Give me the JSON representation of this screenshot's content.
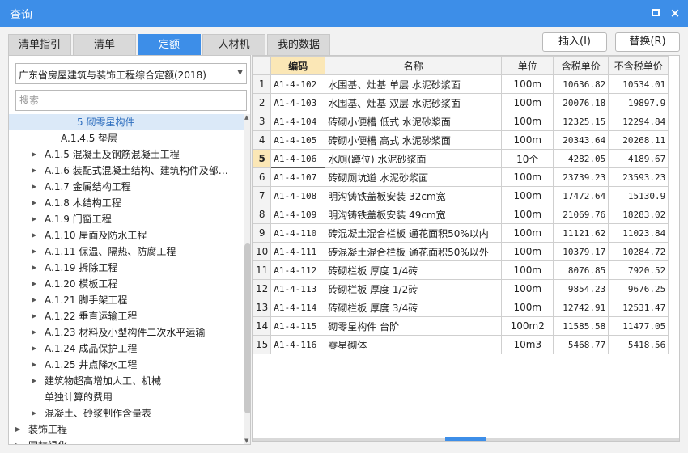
{
  "window": {
    "title": "查询",
    "maximize_label": "",
    "close_label": "×"
  },
  "tabs": [
    {
      "label": "清单指引"
    },
    {
      "label": "清单"
    },
    {
      "label": "定额"
    },
    {
      "label": "人材机"
    },
    {
      "label": "我的数据"
    }
  ],
  "active_tab": 2,
  "actions": {
    "insert_label": "插入(I)",
    "replace_label": "替换(R)"
  },
  "left": {
    "library": "广东省房屋建筑与装饰工程综合定额(2018)",
    "search_placeholder": "搜索",
    "tree": [
      {
        "label": "5 砌零星构件",
        "caret": "",
        "selected": true
      },
      {
        "label": "A.1.4.5 垫层",
        "caret": ""
      },
      {
        "label": "A.1.5 混凝土及钢筋混凝土工程",
        "caret": "▶"
      },
      {
        "label": "A.1.6 装配式混凝土结构、建筑构件及部…",
        "caret": "▶"
      },
      {
        "label": "A.1.7 金属结构工程",
        "caret": "▶"
      },
      {
        "label": "A.1.8 木结构工程",
        "caret": "▶"
      },
      {
        "label": "A.1.9 门窗工程",
        "caret": "▶"
      },
      {
        "label": "A.1.10 屋面及防水工程",
        "caret": "▶"
      },
      {
        "label": "A.1.11 保温、隔热、防腐工程",
        "caret": "▶"
      },
      {
        "label": "A.1.19 拆除工程",
        "caret": "▶"
      },
      {
        "label": "A.1.20 模板工程",
        "caret": "▶"
      },
      {
        "label": "A.1.21 脚手架工程",
        "caret": "▶"
      },
      {
        "label": "A.1.22 垂直运输工程",
        "caret": "▶"
      },
      {
        "label": "A.1.23 材料及小型构件二次水平运输",
        "caret": "▶"
      },
      {
        "label": "A.1.24 成品保护工程",
        "caret": "▶"
      },
      {
        "label": "A.1.25 井点降水工程",
        "caret": "▶"
      },
      {
        "label": "建筑物超高增加人工、机械",
        "caret": "▶"
      },
      {
        "label": "单独计算的费用",
        "caret": ""
      },
      {
        "label": "混凝土、砂浆制作含量表",
        "caret": "▶"
      },
      {
        "label": "装饰工程",
        "caret": "▶"
      },
      {
        "label": "园林绿化",
        "caret": "▶"
      }
    ]
  },
  "grid": {
    "headers": [
      "",
      "编码",
      "名称",
      "单位",
      "含税单价",
      "不含税单价"
    ],
    "current_row": 5,
    "rows": [
      [
        "1",
        "A1-4-102",
        "水围基、灶基 单层 水泥砂浆面",
        "100m",
        "10636.82",
        "10534.01"
      ],
      [
        "2",
        "A1-4-103",
        "水围基、灶基 双层 水泥砂浆面",
        "100m",
        "20076.18",
        "19897.9"
      ],
      [
        "3",
        "A1-4-104",
        "砖砌小便槽 低式 水泥砂浆面",
        "100m",
        "12325.15",
        "12294.84"
      ],
      [
        "4",
        "A1-4-105",
        "砖砌小便槽 高式 水泥砂浆面",
        "100m",
        "20343.64",
        "20268.11"
      ],
      [
        "5",
        "A1-4-106",
        "水厕(蹲位) 水泥砂浆面",
        "10个",
        "4282.05",
        "4189.67"
      ],
      [
        "6",
        "A1-4-107",
        "砖砌厕坑道 水泥砂浆面",
        "100m",
        "23739.23",
        "23593.23"
      ],
      [
        "7",
        "A1-4-108",
        "明沟铸铁盖板安装 32cm宽",
        "100m",
        "17472.64",
        "15130.9"
      ],
      [
        "8",
        "A1-4-109",
        "明沟铸铁盖板安装 49cm宽",
        "100m",
        "21069.76",
        "18283.02"
      ],
      [
        "9",
        "A1-4-110",
        "砖混凝土混合栏板 通花面积50%以内",
        "100m",
        "11121.62",
        "11023.84"
      ],
      [
        "10",
        "A1-4-111",
        "砖混凝土混合栏板 通花面积50%以外",
        "100m",
        "10379.17",
        "10284.72"
      ],
      [
        "11",
        "A1-4-112",
        "砖砌栏板 厚度 1/4砖",
        "100m",
        "8076.85",
        "7920.52"
      ],
      [
        "12",
        "A1-4-113",
        "砖砌栏板 厚度 1/2砖",
        "100m",
        "9854.23",
        "9676.25"
      ],
      [
        "13",
        "A1-4-114",
        "砖砌栏板 厚度 3/4砖",
        "100m",
        "12742.91",
        "12531.47"
      ],
      [
        "14",
        "A1-4-115",
        "砌零星构件 台阶",
        "100m2",
        "11585.58",
        "11477.05"
      ],
      [
        "15",
        "A1-4-116",
        "零星砌体",
        "10m3",
        "5468.77",
        "5418.56"
      ]
    ]
  }
}
